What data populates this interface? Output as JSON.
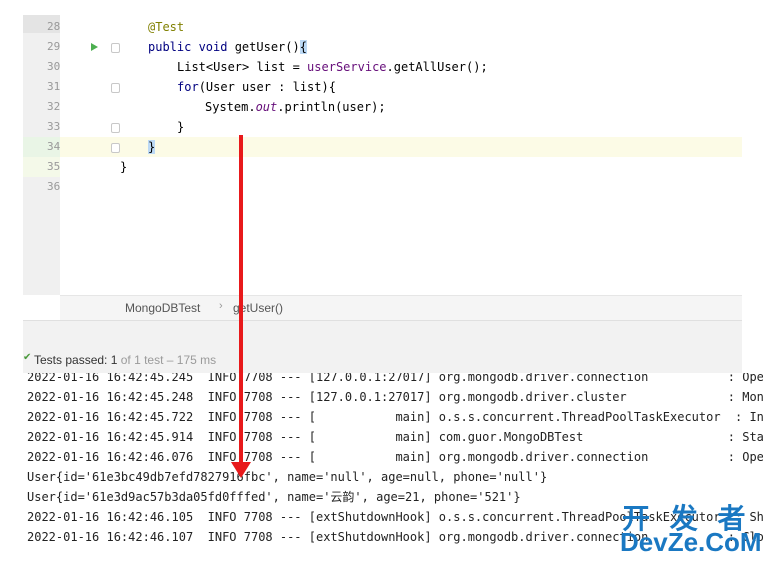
{
  "editor": {
    "lines": [
      {
        "num": "28",
        "code": [
          "@Test"
        ]
      },
      {
        "num": "29",
        "code": [
          "public void",
          " getUser()",
          "{"
        ]
      },
      {
        "num": "30",
        "code": [
          "List<User> list = ",
          "userService",
          ".getAllUser();"
        ]
      },
      {
        "num": "31",
        "code": [
          "for",
          "(User user : list){"
        ]
      },
      {
        "num": "32",
        "code": [
          "System.",
          "out",
          ".println(user);"
        ]
      },
      {
        "num": "33",
        "code": [
          "}"
        ]
      },
      {
        "num": "34",
        "code": [
          "}"
        ]
      },
      {
        "num": "35",
        "code": [
          "}"
        ]
      },
      {
        "num": "36",
        "code": [
          ""
        ]
      }
    ]
  },
  "breadcrumb": {
    "class_name": "MongoDBTest",
    "separator": "›",
    "method_name": "getUser()"
  },
  "tests": {
    "check_icon": "checkmark-icon",
    "passed_label": "Tests passed:",
    "passed_count": "1",
    "rest": "of 1 test – 175 ms"
  },
  "console": {
    "lines": [
      "2022-01-16 16:42:45.245  INFO 7708 --- [127.0.0.1:27017] org.mongodb.driver.connection           : Ope",
      "2022-01-16 16:42:45.248  INFO 7708 --- [127.0.0.1:27017] org.mongodb.driver.cluster              : Mon",
      "2022-01-16 16:42:45.722  INFO 7708 --- [           main] o.s.s.concurrent.ThreadPoolTaskExecutor  : Ini",
      "2022-01-16 16:42:45.914  INFO 7708 --- [           main] com.guor.MongoDBTest                    : Sta",
      "2022-01-16 16:42:46.076  INFO 7708 --- [           main] org.mongodb.driver.connection           : Ope",
      "User{id='61e3bc49db7efd7827916fbc', name='null', age=null, phone='null'}",
      "User{id='61e3d9ac57b3da05fd0fffed', name='云韵', age=21, phone='521'}",
      "2022-01-16 16:42:46.105  INFO 7708 --- [extShutdownHook] o.s.s.concurrent.ThreadPoolTaskExecutor  : Shu",
      "2022-01-16 16:42:46.107  INFO 7708 --- [extShutdownHook] org.mongodb.driver.connection           : Clo"
    ]
  },
  "watermark": {
    "top": "开 发 者",
    "bottom": "DevZe.CoM"
  },
  "colors": {
    "arrow": "#e8191b",
    "keyword": "#000080",
    "annotation": "#808000",
    "field": "#660e7a",
    "watermark": "#1a78c2"
  }
}
